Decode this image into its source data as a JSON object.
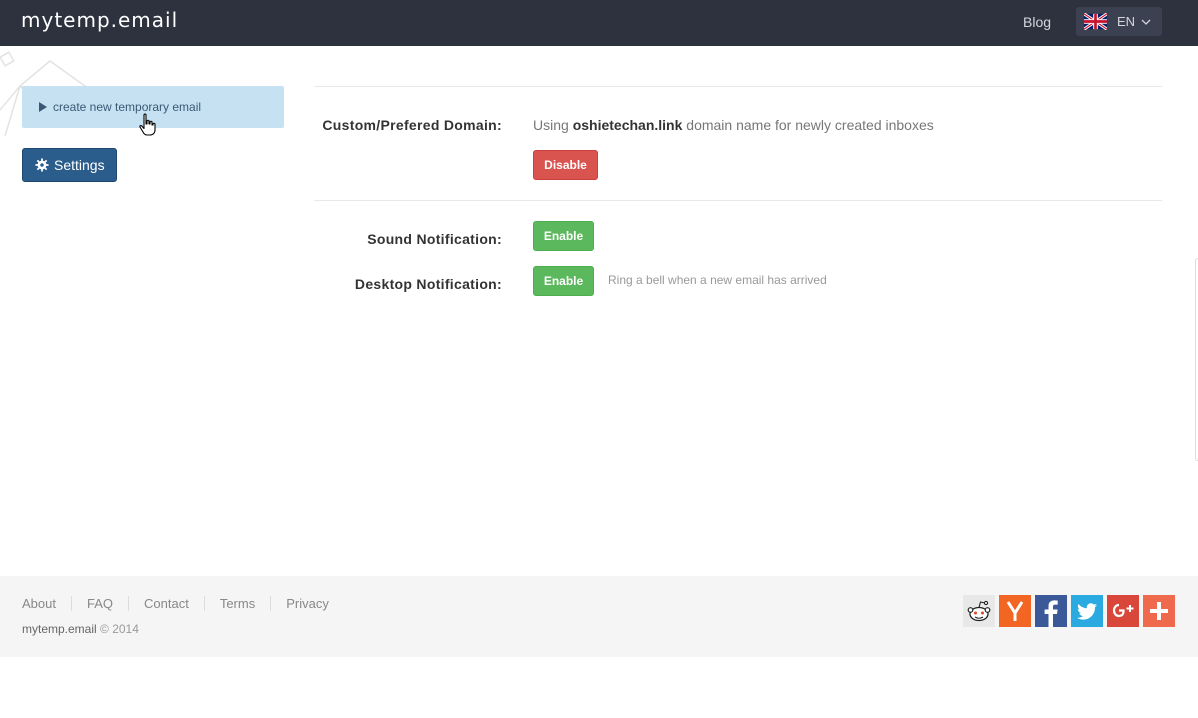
{
  "header": {
    "logo": "mytemp.email",
    "blog_label": "Blog",
    "language_code": "EN",
    "language_flag_icon": "uk-flag-icon"
  },
  "sidebar": {
    "create_label": "create new temporary email",
    "settings_label": "Settings"
  },
  "settings": {
    "custom_domain": {
      "label": "Custom/Prefered Domain:",
      "text_prefix": "Using",
      "domain": "oshietechan.link",
      "text_suffix": "domain name for newly created inboxes",
      "button": "Disable"
    },
    "sound": {
      "label": "Sound Notification:",
      "button": "Enable"
    },
    "desktop": {
      "label": "Desktop Notification:",
      "button": "Enable",
      "hint": "Ring a bell when a new email has arrived"
    }
  },
  "footer": {
    "links": [
      "About",
      "FAQ",
      "Contact",
      "Terms",
      "Privacy"
    ],
    "copyright_brand": "mytemp.email",
    "copyright_text": "© 2014",
    "social": [
      {
        "icon": "reddit-icon",
        "color": "#e8e8e8"
      },
      {
        "icon": "hackernews-icon",
        "color": "#f26522"
      },
      {
        "icon": "facebook-icon",
        "color": "#3b5998"
      },
      {
        "icon": "twitter-icon",
        "color": "#2ba9e1"
      },
      {
        "icon": "googleplus-icon",
        "color": "#d9473b"
      },
      {
        "icon": "share-plus-icon",
        "color": "#ef6a4c"
      }
    ]
  },
  "colors": {
    "topbar": "#2d323e",
    "create_button_bg": "#c6e2f2",
    "settings_button_bg": "#2b5d8c",
    "danger": "#d9534f",
    "success": "#5cb85c"
  }
}
